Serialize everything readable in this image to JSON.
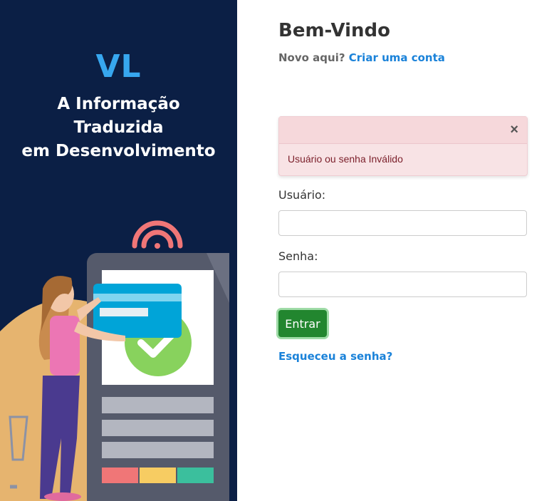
{
  "brand": {
    "logo": "VL",
    "tagline": [
      "A Informação",
      "Traduzida",
      "em Desenvolvimento"
    ]
  },
  "login": {
    "title": "Bem-Vindo",
    "new_here": "Novo aqui?",
    "create_account": "Criar uma conta",
    "alert": {
      "close_symbol": "×",
      "message": "Usuário ou senha Inválido"
    },
    "username_label": "Usuário:",
    "username_value": "",
    "password_label": "Senha:",
    "password_value": "",
    "submit": "Entrar",
    "forgot_password": "Esqueceu a senha?"
  },
  "icons": [
    "credit-card-icon",
    "check-icon",
    "wifi-signal-icon",
    "shopping-cart-icon"
  ],
  "colors": {
    "sidebar_bg": "#0b1f45",
    "logo": "#37a7ef",
    "link": "#1a82d9",
    "submit_bg": "#22862f",
    "alert_bg": "#f8e3e5",
    "alert_text": "#7b1f2a"
  }
}
